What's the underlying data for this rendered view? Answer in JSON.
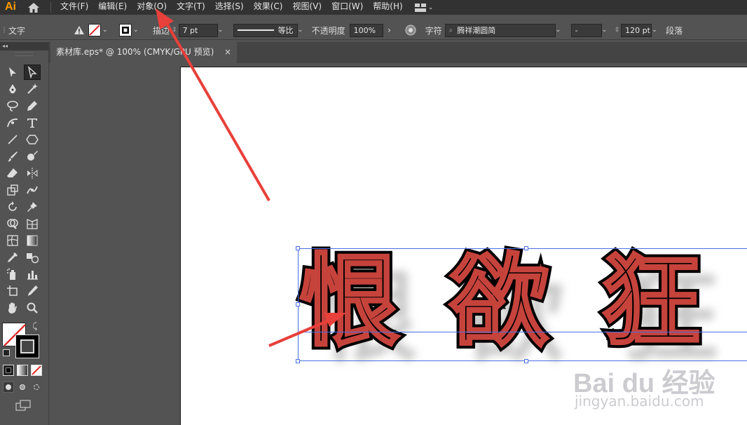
{
  "app": {
    "logo": "Ai",
    "accent": "#ff9a00"
  },
  "menu": [
    "文件(F)",
    "编辑(E)",
    "对象(O)",
    "文字(T)",
    "选择(S)",
    "效果(C)",
    "视图(V)",
    "窗口(W)",
    "帮助(H)"
  ],
  "control": {
    "mode_label": "文字",
    "stroke_label": "描边",
    "stroke_value": "7 pt",
    "brush_label": "等比",
    "opacity_label": "不透明度",
    "opacity_value": "100%",
    "char_label": "字符",
    "font_name": "腾祥潮圆简",
    "font_style": "-",
    "font_size": "120 pt",
    "para_label": "段落"
  },
  "document": {
    "tab_title": "素材库.eps* @ 100% (CMYK/GPU 预览)",
    "close": "×"
  },
  "artwork": {
    "chars": [
      "恨",
      "欲",
      "狂"
    ],
    "stroke_color": "#c6433c",
    "fill_color": "#000000"
  },
  "watermark": {
    "logo": "Bai du 经验",
    "url": "jingyan.baidu.com"
  },
  "annotations": {
    "arrow_color": "#e8403a"
  }
}
